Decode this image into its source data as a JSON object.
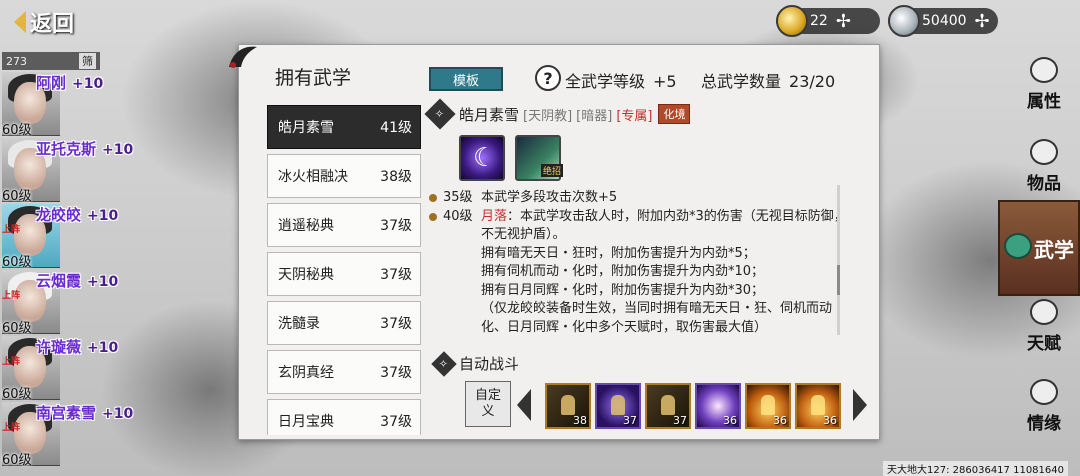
{
  "top": {
    "back_label": "返回",
    "gold": "22",
    "silver": "50400"
  },
  "party": {
    "count": "273",
    "sort_label": "筛",
    "members": [
      {
        "name": "阿刚",
        "bonus": "+10",
        "level": "60级",
        "tag": ""
      },
      {
        "name": "亚托克斯",
        "bonus": "+10",
        "level": "60级",
        "tag": ""
      },
      {
        "name": "龙皎皎",
        "bonus": "+10",
        "level": "60级",
        "tag": "上阵"
      },
      {
        "name": "云烟霞",
        "bonus": "+10",
        "level": "60级",
        "tag": "上阵"
      },
      {
        "name": "许璇薇",
        "bonus": "+10",
        "level": "60级",
        "tag": "上阵"
      },
      {
        "name": "南宫素雪",
        "bonus": "+10",
        "level": "60级",
        "tag": "上阵"
      }
    ]
  },
  "panel": {
    "title": "拥有武学",
    "template_label": "模板",
    "help_icon": "?",
    "stat1_label": "全武学等级",
    "stat1_value": "+5",
    "stat2_label": "总武学数量",
    "stat2_value": "23/20"
  },
  "skills": [
    {
      "name": "皓月素雪",
      "level": "41级"
    },
    {
      "name": "冰火相融决",
      "level": "38级"
    },
    {
      "name": "逍遥秘典",
      "level": "37级"
    },
    {
      "name": "天阴秘典",
      "level": "37级"
    },
    {
      "name": "洗髓录",
      "level": "37级"
    },
    {
      "name": "玄阴真经",
      "level": "37级"
    },
    {
      "name": "日月宝典",
      "level": "37级"
    }
  ],
  "detail": {
    "name": "皓月素雪",
    "tag1": "[天阴教]",
    "tag2": "[暗器]",
    "tag3": "[专属]",
    "realm": "化境",
    "badge": "绝招",
    "effects": [
      {
        "lv": "35级",
        "text": "本武学多段攻击次数+5"
      },
      {
        "lv": "40级",
        "highlight": "月落",
        "text": "：本武学攻击敌人时，附加内劲*3的伤害（无视目标防御，不无视护盾）。"
      }
    ],
    "extra_lines": [
      "拥有暗无天日・狂时，附加伤害提升为内劲*5；",
      "拥有伺机而动・化时，附加伤害提升为内劲*10；",
      "拥有日月同辉・化时，附加伤害提升为内劲*30；",
      "（仅龙皎皎装备时生效，当同时拥有暗无天日・狂、伺机而动・化、日月同辉・化中多个天赋时，取伤害最大值）"
    ]
  },
  "auto_battle": {
    "title": "自动战斗",
    "custom_label": "自定义",
    "slots": [
      "38",
      "37",
      "37",
      "36",
      "36",
      "36"
    ]
  },
  "sidebar": {
    "tabs": [
      "属性",
      "物品",
      "武学",
      "天赋",
      "情缘"
    ]
  },
  "footer": {
    "coords": "天大地大127: 286036417  11081640"
  }
}
